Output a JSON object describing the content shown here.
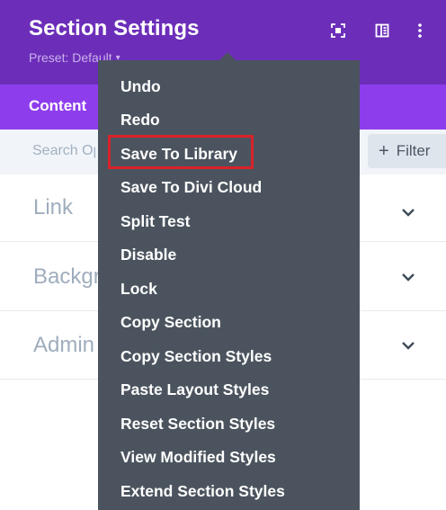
{
  "header": {
    "title": "Section Settings",
    "preset_label": "Preset: Default",
    "icons": [
      "fullscreen-icon",
      "split-view-icon",
      "more-icon"
    ]
  },
  "tabs": [
    {
      "label": "Content",
      "active": true
    }
  ],
  "search": {
    "placeholder": "Search Options",
    "filter_label": "Filter"
  },
  "toggles": [
    {
      "label": "Link"
    },
    {
      "label": "Background"
    },
    {
      "label": "Admin Label"
    }
  ],
  "menu": {
    "items": [
      {
        "label": "Undo"
      },
      {
        "label": "Redo"
      },
      {
        "label": "Save To Library",
        "highlighted": true
      },
      {
        "label": "Save To Divi Cloud"
      },
      {
        "label": "Split Test"
      },
      {
        "label": "Disable"
      },
      {
        "label": "Lock"
      },
      {
        "label": "Copy Section"
      },
      {
        "label": "Copy Section Styles"
      },
      {
        "label": "Paste Layout Styles"
      },
      {
        "label": "Reset Section Styles"
      },
      {
        "label": "View Modified Styles"
      },
      {
        "label": "Extend Section Styles"
      }
    ]
  },
  "colors": {
    "header_bg": "#6c2eb9",
    "tabs_bg": "#8e3ded",
    "menu_bg": "#4b545e",
    "highlight_border": "#d9222a"
  }
}
